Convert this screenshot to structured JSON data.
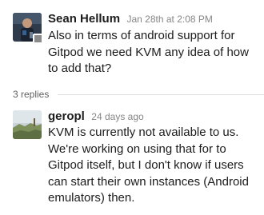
{
  "messages": [
    {
      "author": "Sean Hellum",
      "timestamp": "Jan 28th at 2:08 PM",
      "text": "Also in terms of android support for Gitpod we need KVM any idea of how to add that?",
      "avatar_icon": "user-photo-icon",
      "presence": "away"
    },
    {
      "author": "geropl",
      "timestamp": "24 days ago",
      "text": "KVM is currently not available to us. We're working on using that for to Gitpod itself, but I don't know if users can start their own instances (Android emulators) then.",
      "avatar_icon": "landscape-photo-icon"
    }
  ],
  "thread": {
    "replies_label": "3 replies"
  },
  "colors": {
    "text": "#1d1c1d",
    "muted": "#868686",
    "divider": "#dddddd",
    "presence_away": "#8a8a8a"
  }
}
